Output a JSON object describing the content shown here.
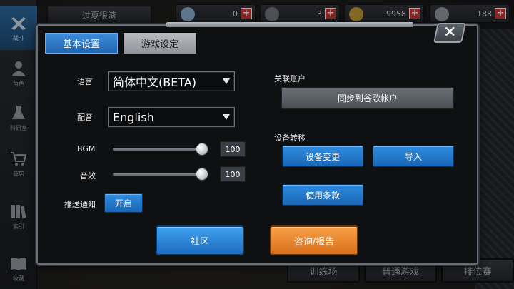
{
  "background": {
    "top_title": "过夏很渣",
    "resources": [
      {
        "icon": "gem-icon",
        "value": "0",
        "color": "#8fb5d9"
      },
      {
        "icon": "ticket-icon",
        "value": "3",
        "color": "#777b82"
      },
      {
        "icon": "gold-coin-icon",
        "value": "9958",
        "color": "#c9a23a"
      },
      {
        "icon": "bp-badge-icon",
        "value": "188",
        "color": "#9aa0a8"
      }
    ],
    "nav": [
      {
        "label": "战斗",
        "icon": "crossed-guns-icon"
      },
      {
        "label": "角色",
        "icon": "character-icon"
      },
      {
        "label": "科研室",
        "icon": "flask-icon"
      },
      {
        "label": "商店",
        "icon": "cart-icon"
      },
      {
        "label": "索引",
        "icon": "books-icon"
      },
      {
        "label": "收藏",
        "icon": "open-book-icon"
      }
    ],
    "bottom_tabs": [
      "训练场",
      "普通游戏",
      "排位赛"
    ]
  },
  "settings": {
    "tabs": {
      "basic": "基本设置",
      "game": "游戏设定"
    },
    "language": {
      "label": "语言",
      "value": "简体中文(BETA)"
    },
    "voice": {
      "label": "配音",
      "value": "English"
    },
    "bgm": {
      "label": "BGM",
      "value": "100",
      "level_percent": 100
    },
    "sfx": {
      "label": "音效",
      "value": "100",
      "level_percent": 100
    },
    "push": {
      "label": "推送通知",
      "button": "开启"
    },
    "linked_account": {
      "label": "关联账户",
      "button": "同步到谷歌帐户"
    },
    "device_transfer": {
      "label": "设备转移",
      "change_button": "设备变更",
      "import_button": "导入"
    },
    "terms_button": "使用条款",
    "community_button": "社区",
    "support_button": "咨询/报告"
  },
  "colors": {
    "accent_blue": "#2a7fd4",
    "accent_orange": "#e8872f",
    "danger_red": "#d23a3a"
  }
}
